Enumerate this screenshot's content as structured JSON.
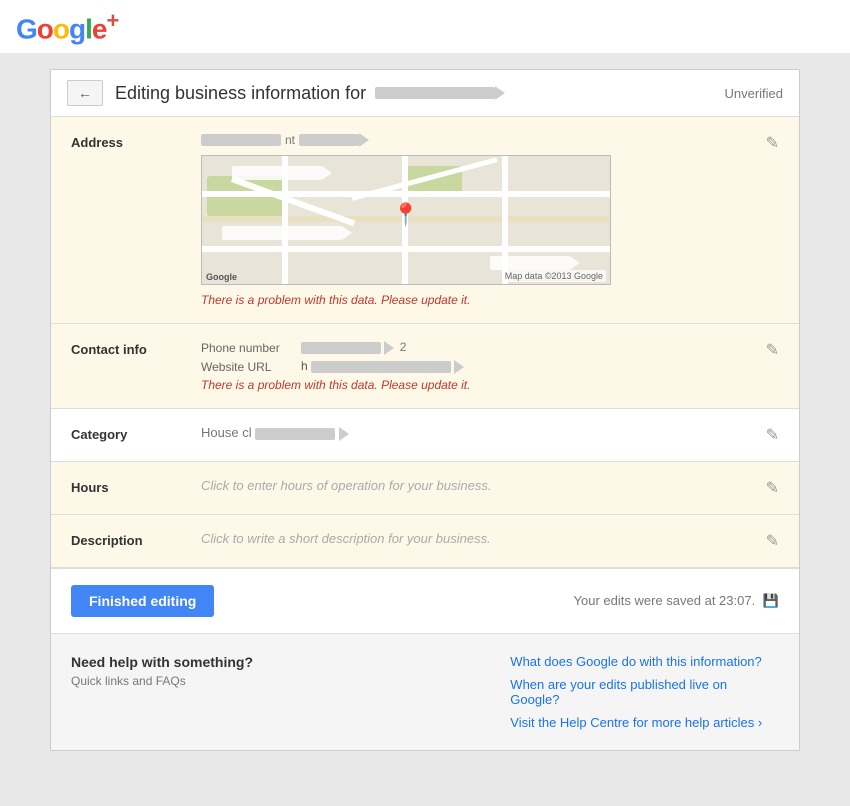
{
  "topbar": {
    "logo": {
      "text": "Google+",
      "letters": [
        "G",
        "o",
        "o",
        "g",
        "l",
        "e",
        "+"
      ]
    }
  },
  "header": {
    "back_label": "←",
    "title": "Editing business information for",
    "business_name": "— — — — —",
    "unverified_label": "Unverified"
  },
  "sections": {
    "address": {
      "label": "Address",
      "error": "There is a problem with this data. Please update it.",
      "map_copyright": "Map data ©2013 Google"
    },
    "contact_info": {
      "label": "Contact info",
      "phone_label": "Phone number",
      "phone_value": "—2",
      "website_label": "Website URL",
      "website_value": "h————————————————",
      "error": "There is a problem with this data. Please update it."
    },
    "category": {
      "label": "Category",
      "value": "House cl————————"
    },
    "hours": {
      "label": "Hours",
      "placeholder": "Click to enter hours of operation for your business."
    },
    "description": {
      "label": "Description",
      "placeholder": "Click to write a short description for your business."
    }
  },
  "footer": {
    "finished_button": "Finished editing",
    "saved_text": "Your edits were saved at 23:07."
  },
  "help": {
    "title": "Need help with something?",
    "subtitle": "Quick links and FAQs",
    "links": [
      "What does Google do with this information?",
      "When are your edits published live on Google?",
      "Visit the Help Centre for more help articles ›"
    ]
  },
  "icons": {
    "back": "←",
    "edit": "✎",
    "save": "💾"
  }
}
